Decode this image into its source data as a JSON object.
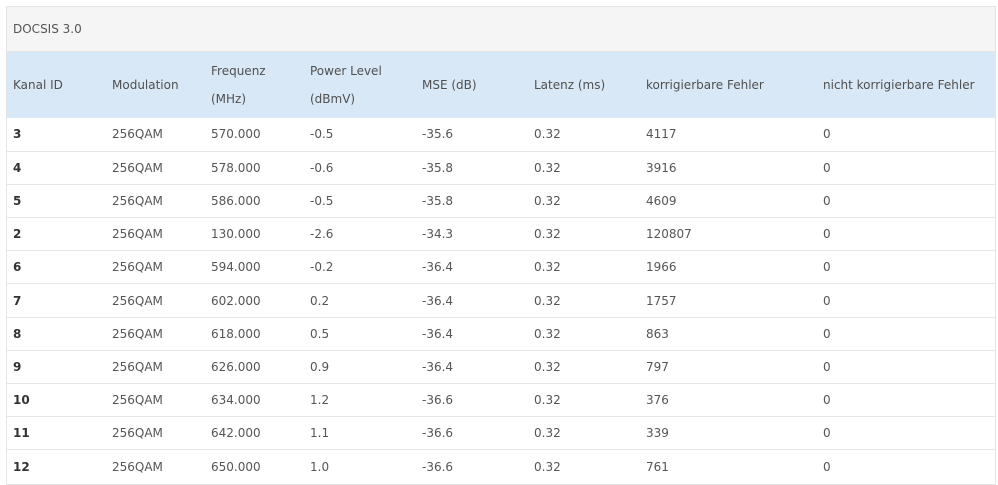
{
  "panel": {
    "title": "DOCSIS 3.0"
  },
  "table": {
    "headers": {
      "kanal_id": "Kanal ID",
      "modulation": "Modulation",
      "frequenz": "Frequenz (MHz)",
      "power_level_line1": "Power Level",
      "power_level_line2": "(dBmV)",
      "mse": "MSE (dB)",
      "latenz": "Latenz (ms)",
      "korrigierbare": "korrigierbare Fehler",
      "nicht_korrigierbare": "nicht korrigierbare Fehler"
    },
    "rows": [
      [
        "3",
        "256QAM",
        "570.000",
        "-0.5",
        "-35.6",
        "0.32",
        "4117",
        "0"
      ],
      [
        "4",
        "256QAM",
        "578.000",
        "-0.6",
        "-35.8",
        "0.32",
        "3916",
        "0"
      ],
      [
        "5",
        "256QAM",
        "586.000",
        "-0.5",
        "-35.8",
        "0.32",
        "4609",
        "0"
      ],
      [
        "2",
        "256QAM",
        "130.000",
        "-2.6",
        "-34.3",
        "0.32",
        "120807",
        "0"
      ],
      [
        "6",
        "256QAM",
        "594.000",
        "-0.2",
        "-36.4",
        "0.32",
        "1966",
        "0"
      ],
      [
        "7",
        "256QAM",
        "602.000",
        "0.2",
        "-36.4",
        "0.32",
        "1757",
        "0"
      ],
      [
        "8",
        "256QAM",
        "618.000",
        "0.5",
        "-36.4",
        "0.32",
        "863",
        "0"
      ],
      [
        "9",
        "256QAM",
        "626.000",
        "0.9",
        "-36.4",
        "0.32",
        "797",
        "0"
      ],
      [
        "10",
        "256QAM",
        "634.000",
        "1.2",
        "-36.6",
        "0.32",
        "376",
        "0"
      ],
      [
        "11",
        "256QAM",
        "642.000",
        "1.1",
        "-36.6",
        "0.32",
        "339",
        "0"
      ],
      [
        "12",
        "256QAM",
        "650.000",
        "1.0",
        "-36.6",
        "0.32",
        "761",
        "0"
      ]
    ]
  },
  "colors": {
    "header_background": "#d8e8f6",
    "title_background": "#f5f5f5"
  }
}
